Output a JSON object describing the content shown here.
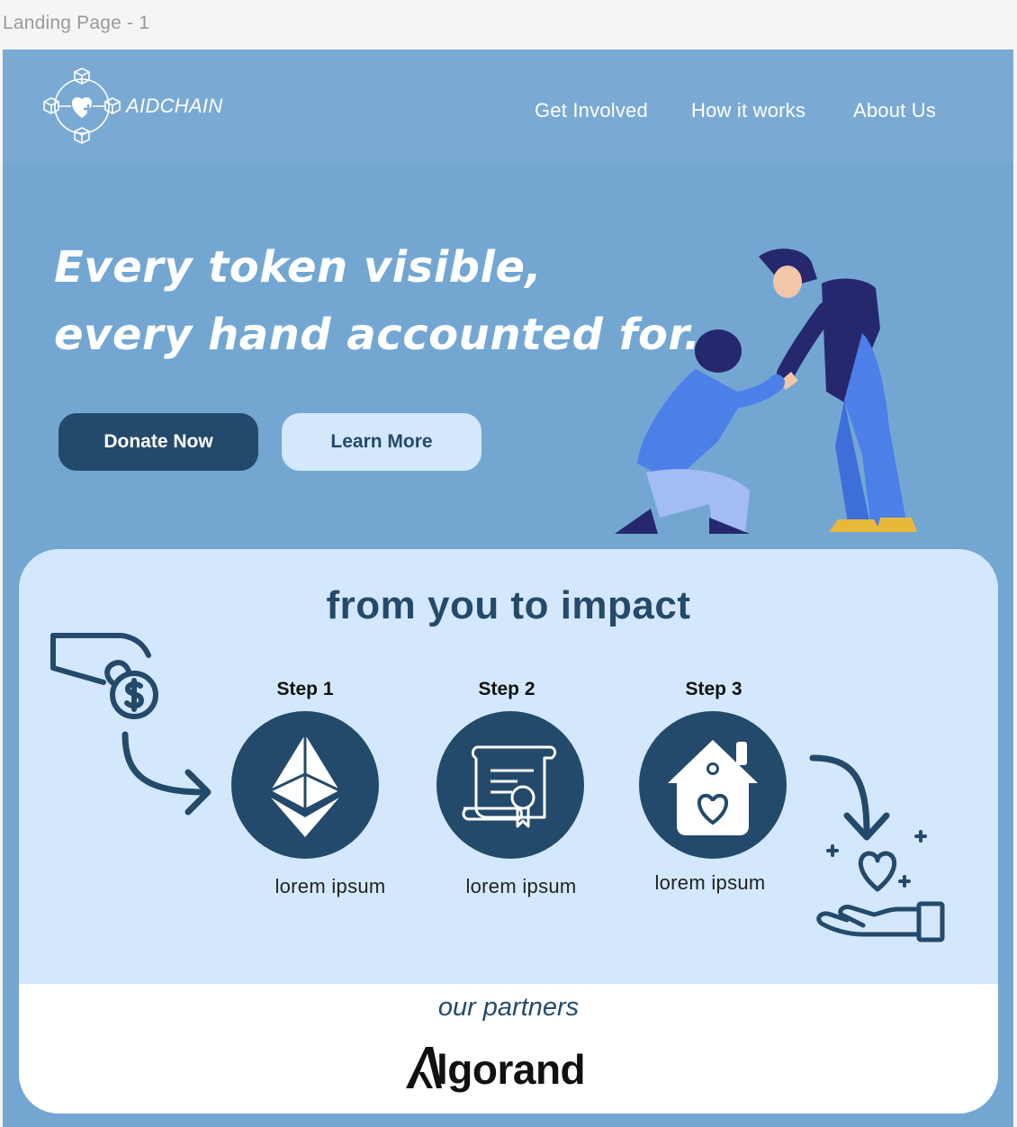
{
  "frame": {
    "label": "Landing Page - 1"
  },
  "nav": {
    "logo_text": "AIDCHAIN",
    "links": [
      "Get Involved",
      "How it works",
      "About Us"
    ]
  },
  "hero": {
    "title_line1": "Every token visible,",
    "title_line2": "every hand accounted for.",
    "donate_label": "Donate Now",
    "learn_label": "Learn More"
  },
  "impact": {
    "title": "from you to impact",
    "steps": [
      {
        "label": "Step 1",
        "caption": "lorem ipsum",
        "icon": "ethereum-icon"
      },
      {
        "label": "Step 2",
        "caption": "lorem ipsum",
        "icon": "certificate-icon"
      },
      {
        "label": "Step 3",
        "caption": "lorem ipsum",
        "icon": "house-heart-icon"
      }
    ]
  },
  "partners": {
    "title": "our partners",
    "partner_name": "lgorand"
  },
  "colors": {
    "navy": "#244a6b",
    "hero_bg": "#73a7d2",
    "card_bg": "#d3e8fc",
    "accent_light": "#d4e8fb"
  }
}
